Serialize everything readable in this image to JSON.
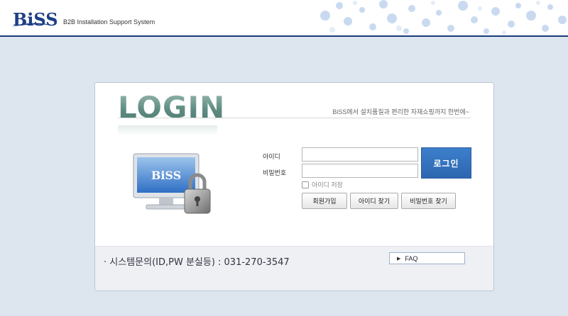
{
  "header": {
    "logo_text": "BiSS",
    "tagline": "B2B Installation Support System",
    "accent_color": "#1a3a78"
  },
  "login": {
    "title": "LOGIN",
    "slogan": "BiSS에서 설치품질과 편리한 자재쇼핑까지 한번에~",
    "monitor_logo": "BiSS",
    "id_label": "아이디",
    "pw_label": "비밀번호",
    "id_value": "",
    "pw_value": "",
    "login_button": "로그인",
    "save_id_label": "아이디 저장",
    "signup_button": "회원가입",
    "find_id_button": "아이디 찾기",
    "find_pw_button": "비밀번호 찾기"
  },
  "footer": {
    "contact": "· 시스템문의(ID,PW 분실등) : 031-270-3547",
    "faq_label": "FAQ"
  },
  "icons": [
    "monitor-icon",
    "padlock-icon",
    "triangle-right-icon",
    "checkbox-icon"
  ]
}
